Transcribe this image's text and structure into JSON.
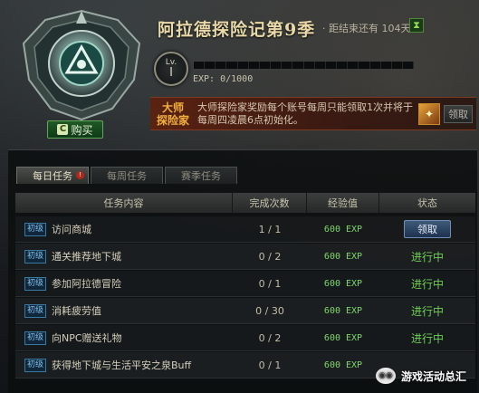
{
  "header": {
    "title": "阿拉德探险记第9季",
    "countdown": "· 距结束还有 104天",
    "hourglass_icon": "hourglass-icon"
  },
  "level": {
    "label": "Lv.",
    "value": "I",
    "exp_text": "EXP: 0/1000",
    "exp_progress": 0
  },
  "buy": {
    "label": "购买"
  },
  "master": {
    "badge_line1": "大师",
    "badge_line2": "探险家",
    "text": "大师探险家奖励每个账号每周只能领取1次并将于每周四凌晨6点初始化。",
    "claim_label": "领取"
  },
  "tabs": [
    {
      "label": "每日任务",
      "active": true,
      "alert": "!"
    },
    {
      "label": "每周任务",
      "active": false
    },
    {
      "label": "赛季任务",
      "active": false
    }
  ],
  "table": {
    "headers": [
      "任务内容",
      "完成次数",
      "经验值",
      "状态"
    ],
    "rows": [
      {
        "grade": "初级",
        "task": "访问商城",
        "count": "1 / 1",
        "exp": "600 EXP",
        "status": "领取",
        "status_type": "button"
      },
      {
        "grade": "初级",
        "task": "通关推荐地下城",
        "count": "0 / 2",
        "exp": "600 EXP",
        "status": "进行中",
        "status_type": "text"
      },
      {
        "grade": "初级",
        "task": "参加阿拉德冒险",
        "count": "0 / 1",
        "exp": "600 EXP",
        "status": "进行中",
        "status_type": "text"
      },
      {
        "grade": "初级",
        "task": "消耗疲劳值",
        "count": "0 / 30",
        "exp": "600 EXP",
        "status": "进行中",
        "status_type": "text"
      },
      {
        "grade": "初级",
        "task": "向NPC赠送礼物",
        "count": "0 / 2",
        "exp": "600 EXP",
        "status": "进行中",
        "status_type": "text"
      },
      {
        "grade": "初级",
        "task": "获得地下城与生活平安之泉Buff",
        "count": "0 / 1",
        "exp": "600 EXP",
        "status": "",
        "status_type": "text"
      }
    ]
  },
  "watermark": {
    "text": "游戏活动总汇"
  },
  "colors": {
    "accent_green": "#6fcf57",
    "title_gold": "#e9d9a8",
    "master_orange": "#f2b13c"
  }
}
